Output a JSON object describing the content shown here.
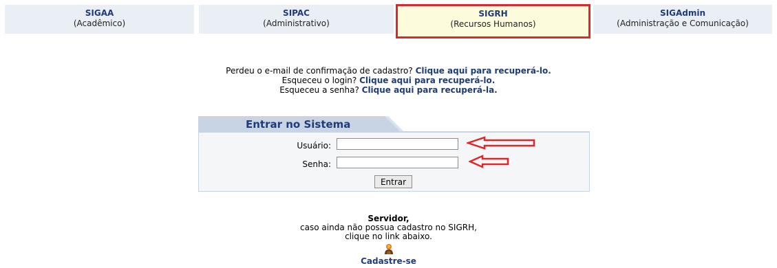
{
  "systems": [
    {
      "name": "SIGAA",
      "subtitle": "(Acadêmico)"
    },
    {
      "name": "SIPAC",
      "subtitle": "(Administrativo)"
    },
    {
      "name": "SIGRH",
      "subtitle": "(Recursos Humanos)"
    },
    {
      "name": "SIGAdmin",
      "subtitle": "(Administração e Comunicação)"
    }
  ],
  "recovery": {
    "email": {
      "text": "Perdeu o e-mail de confirmação de cadastro? ",
      "link": "Clique aqui para recuperá-lo."
    },
    "login": {
      "text": "Esqueceu o login? ",
      "link": "Clique aqui para recuperá-lo."
    },
    "password": {
      "text": "Esqueceu a senha? ",
      "link": "Clique aqui para recuperá-la."
    }
  },
  "login_form": {
    "title": "Entrar no Sistema",
    "user_label": "Usuário:",
    "user_value": "",
    "password_label": "Senha:",
    "password_value": "",
    "submit_label": "Entrar"
  },
  "servidor": {
    "heading": "Servidor,",
    "line1": "caso ainda não possua cadastro no SIGRH,",
    "line2": "clique no link abaixo.",
    "link": "Cadastre-se"
  },
  "colors": {
    "link": "#1f3c78",
    "tab_bg": "#e9eff5",
    "selected_tab_bg": "#fcfbdc",
    "highlight_red": "#e0252b",
    "login_header": "#c8d3e4"
  },
  "icons": [
    "user-icon",
    "red-arrow-icon"
  ]
}
